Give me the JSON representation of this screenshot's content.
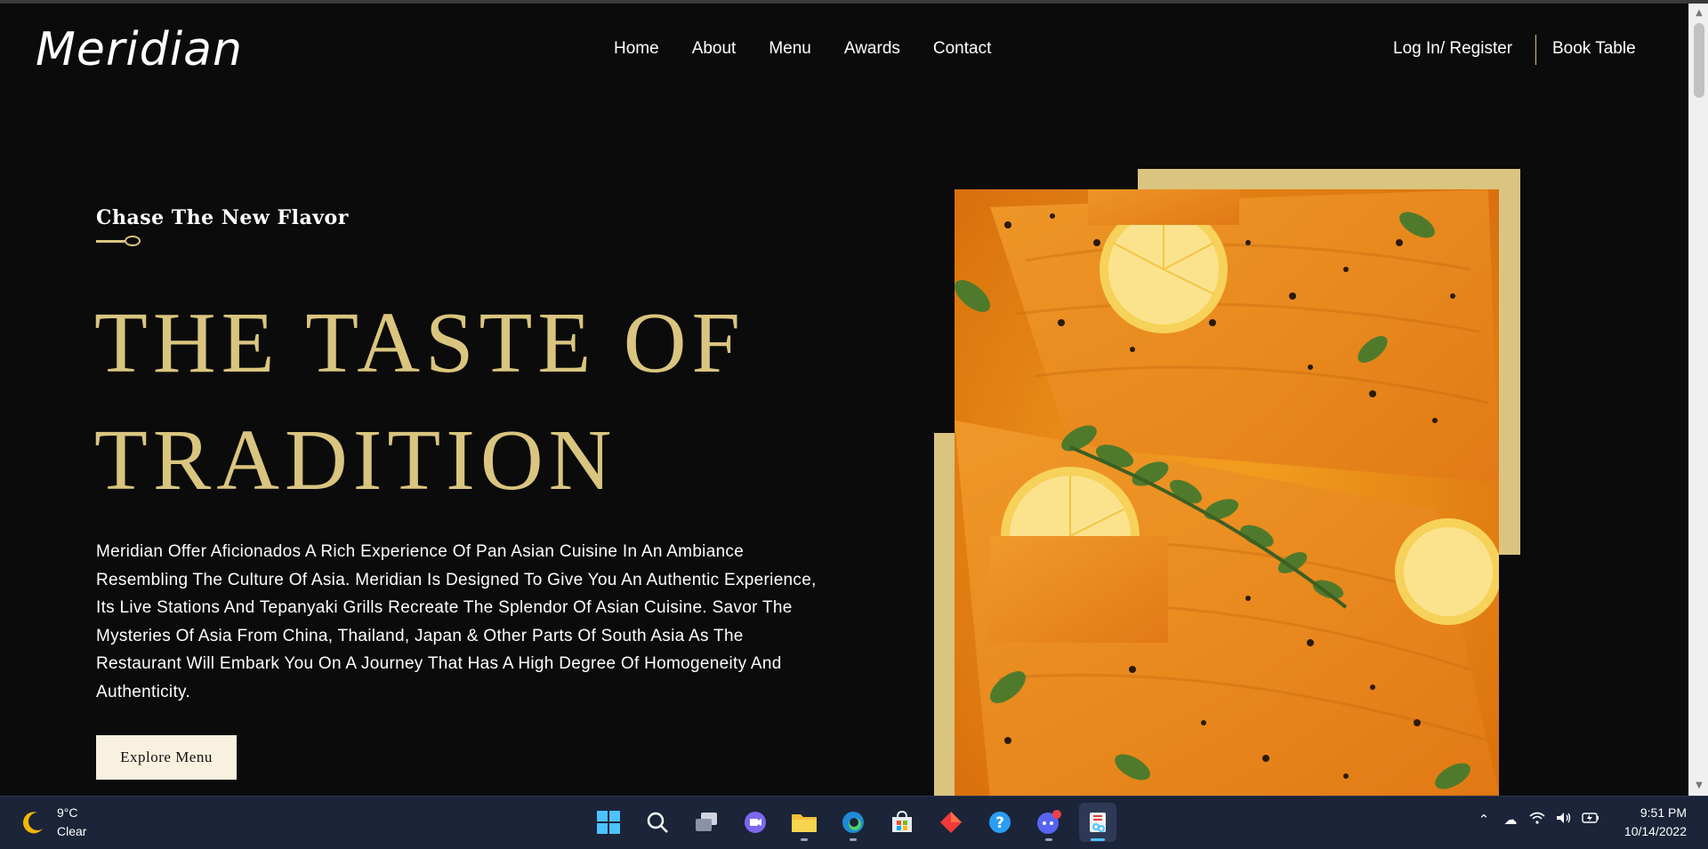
{
  "brand": {
    "logo": "Meridian"
  },
  "nav": {
    "items": [
      {
        "label": "Home"
      },
      {
        "label": "About"
      },
      {
        "label": "Menu"
      },
      {
        "label": "Awards"
      },
      {
        "label": "Contact"
      }
    ],
    "login_label": "Log In/ Register",
    "book_label": "Book Table"
  },
  "hero": {
    "tagline": "Chase The New Flavor",
    "headline_line1": "THE TASTE OF",
    "headline_line2": "TRADITION",
    "description": "Meridian Offer Aficionados A Rich Experience Of Pan Asian Cuisine In An Ambiance Resembling The Culture Of Asia. Meridian Is Designed To Give You An Authentic Experience, Its Live Stations And Tepanyaki Grills Recreate The Splendor Of Asian Cuisine. Savor The Mysteries Of Asia From China, Thailand, Japan & Other Parts Of South Asia As The Restaurant Will Embark You On A Journey That Has A High Degree Of Homogeneity And Authenticity.",
    "cta_label": "Explore Menu",
    "accent_color": "#d9c57f"
  },
  "taskbar": {
    "weather_temp": "9°C",
    "weather_condition": "Clear",
    "apps": [
      {
        "icon": "windows-start-icon"
      },
      {
        "icon": "search-icon"
      },
      {
        "icon": "task-view-icon"
      },
      {
        "icon": "chat-icon"
      },
      {
        "icon": "file-explorer-icon"
      },
      {
        "icon": "edge-browser-icon"
      },
      {
        "icon": "microsoft-store-icon"
      },
      {
        "icon": "red-diamond-app-icon"
      },
      {
        "icon": "help-icon"
      },
      {
        "icon": "discord-icon"
      },
      {
        "icon": "snipping-tool-icon"
      }
    ],
    "tray": [
      "chevron-up-icon",
      "onedrive-cloud-icon",
      "wifi-icon",
      "volume-icon",
      "battery-icon"
    ],
    "time": "9:51 PM",
    "date": "10/14/2022"
  }
}
